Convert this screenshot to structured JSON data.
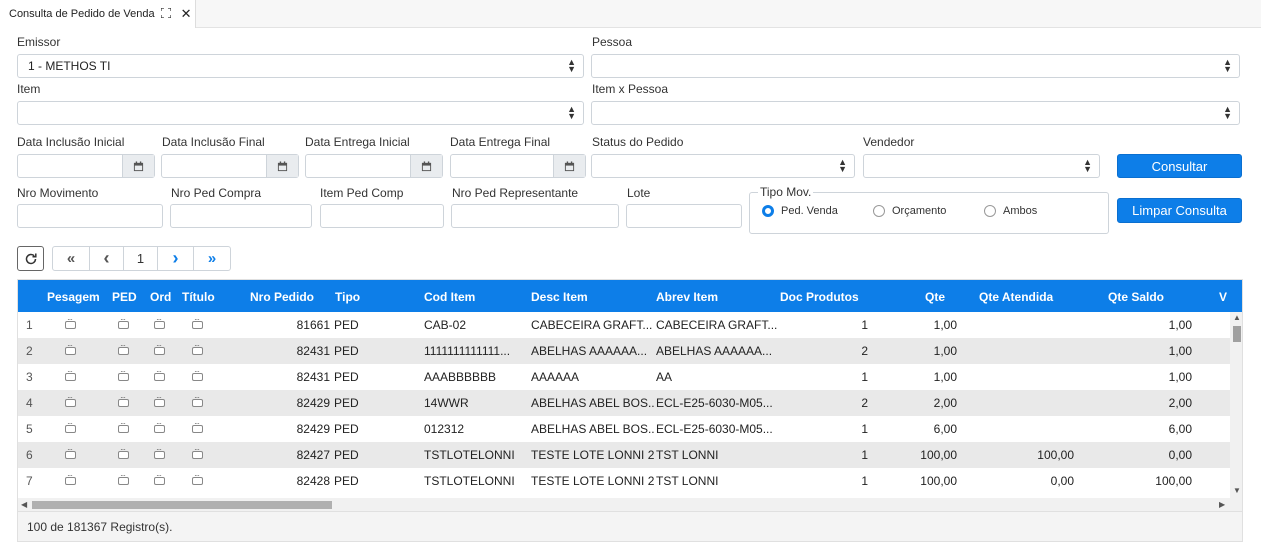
{
  "tab": {
    "title": "Consulta de Pedido de Venda",
    "expand_icon": "expand-icon",
    "close_glyph": "✕"
  },
  "filters": {
    "emissor_label": "Emissor",
    "emissor_value": "1 - METHOS TI",
    "pessoa_label": "Pessoa",
    "pessoa_value": "",
    "item_label": "Item",
    "item_value": "",
    "item_pessoa_label": "Item x Pessoa",
    "item_pessoa_value": "",
    "data_inclusao_inicial_label": "Data Inclusão Inicial",
    "data_inclusao_final_label": "Data Inclusão Final",
    "data_entrega_inicial_label": "Data Entrega Inicial",
    "data_entrega_final_label": "Data Entrega Final",
    "status_label": "Status do Pedido",
    "status_value": "",
    "vendedor_label": "Vendedor",
    "vendedor_value": "",
    "nro_movimento_label": "Nro Movimento",
    "nro_ped_compra_label": "Nro Ped Compra",
    "item_ped_comp_label": "Item Ped Comp",
    "nro_ped_representante_label": "Nro Ped Representante",
    "lote_label": "Lote",
    "tipo_mov_legend": "Tipo Mov.",
    "tipo_mov_options": [
      "Ped. Venda",
      "Orçamento",
      "Ambos"
    ],
    "tipo_mov_selected": "Ped. Venda"
  },
  "buttons": {
    "consultar": "Consultar",
    "limpar": "Limpar Consulta"
  },
  "pagination": {
    "first": "«",
    "prev": "‹",
    "page": "1",
    "next": "›",
    "last": "»",
    "refresh_icon": "refresh-icon"
  },
  "grid": {
    "columns": [
      "Pesagem",
      "PED",
      "Ord",
      "Título",
      "Nro Pedido",
      "Tipo",
      "Cod Item",
      "Desc Item",
      "Abrev Item",
      "Doc Produtos",
      "Qte",
      "Qte Atendida",
      "Qte Saldo",
      "V"
    ],
    "rows": [
      {
        "idx": "1",
        "nro": "81661",
        "tipo": "PED",
        "cod": "CAB-02",
        "desc": "CABECEIRA GRAFT...",
        "abrev": "CABECEIRA GRAFT...",
        "doc": "1",
        "qte": "1,00",
        "atend": "",
        "saldo": "1,00"
      },
      {
        "idx": "2",
        "nro": "82431",
        "tipo": "PED",
        "cod": "1111111111111...",
        "desc": "ABELHAS AAAAAA...",
        "abrev": "ABELHAS AAAAAA...",
        "doc": "2",
        "qte": "1,00",
        "atend": "",
        "saldo": "1,00"
      },
      {
        "idx": "3",
        "nro": "82431",
        "tipo": "PED",
        "cod": "AAABBBBBB",
        "desc": "AAAAAA",
        "abrev": "AA",
        "doc": "1",
        "qte": "1,00",
        "atend": "",
        "saldo": "1,00"
      },
      {
        "idx": "4",
        "nro": "82429",
        "tipo": "PED",
        "cod": "14WWR",
        "desc": "ABELHAS ABEL BOS...",
        "abrev": "ECL-E25-6030-M05...",
        "doc": "2",
        "qte": "2,00",
        "atend": "",
        "saldo": "2,00"
      },
      {
        "idx": "5",
        "nro": "82429",
        "tipo": "PED",
        "cod": "012312",
        "desc": "ABELHAS ABEL BOS...",
        "abrev": "ECL-E25-6030-M05...",
        "doc": "1",
        "qte": "6,00",
        "atend": "",
        "saldo": "6,00"
      },
      {
        "idx": "6",
        "nro": "82427",
        "tipo": "PED",
        "cod": "TSTLOTELONNI",
        "desc": "TESTE LOTE LONNI 2",
        "abrev": "TST LONNI",
        "doc": "1",
        "qte": "100,00",
        "atend": "100,00",
        "saldo": "0,00"
      },
      {
        "idx": "7",
        "nro": "82428",
        "tipo": "PED",
        "cod": "TSTLOTELONNI",
        "desc": "TESTE LOTE LONNI 2",
        "abrev": "TST LONNI",
        "doc": "1",
        "qte": "100,00",
        "atend": "0,00",
        "saldo": "100,00"
      }
    ]
  },
  "footer": {
    "records": "100 de 181367 Registro(s)."
  },
  "colors": {
    "accent": "#0d7ee8",
    "row_alt": "#e9e9e9"
  }
}
